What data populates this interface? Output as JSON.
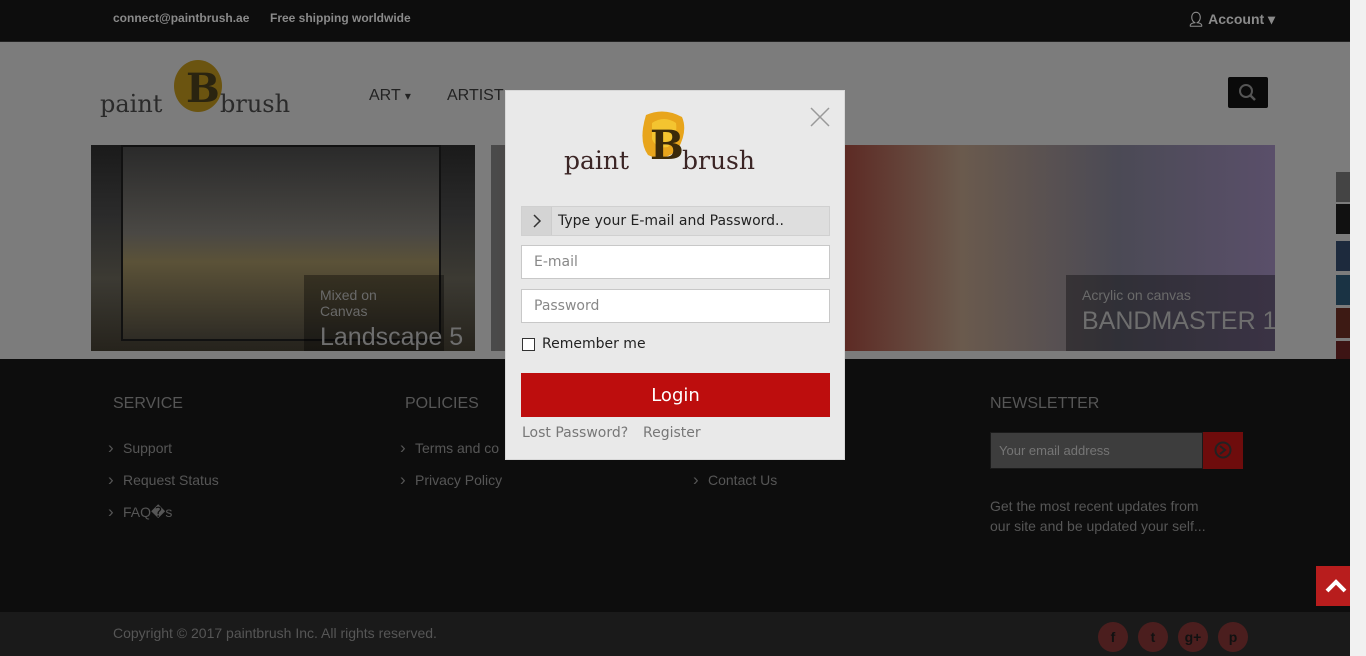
{
  "topbar": {
    "contact": "connect@paintbrush.ae",
    "shipping": "Free shipping worldwide",
    "account": "Account"
  },
  "header": {
    "logo_text": "paintBbrush",
    "nav": [
      "ART",
      "ARTIST"
    ]
  },
  "banners": [
    {
      "subtitle": "Mixed on Canvas",
      "title": "Landscape 5"
    },
    {
      "subtitle": "Acrylic on canvas",
      "title": "BANDMASTER 1"
    }
  ],
  "footer": {
    "service": {
      "title": "SERVICE",
      "links": [
        "Support",
        "Request Status",
        "FAQ�s"
      ]
    },
    "policies": {
      "title": "POLICIES",
      "links": [
        "Terms and co",
        "Privacy Policy"
      ]
    },
    "info": {
      "links": [
        "Contact Us"
      ]
    },
    "newsletter": {
      "title": "NEWSLETTER",
      "placeholder": "Your email address",
      "text": "Get the most recent updates from our site and be updated your self..."
    },
    "copyright": "Copyright © 2017 paintbrush Inc. All rights reserved."
  },
  "modal": {
    "hint": "Type your E-mail and Password..",
    "email_placeholder": "E-mail",
    "password_placeholder": "Password",
    "remember": "Remember me",
    "login": "Login",
    "lost_password": "Lost Password?",
    "register": "Register"
  },
  "colors": {
    "accent": "#bd0d0d",
    "topbar": "#0d0d0d"
  }
}
